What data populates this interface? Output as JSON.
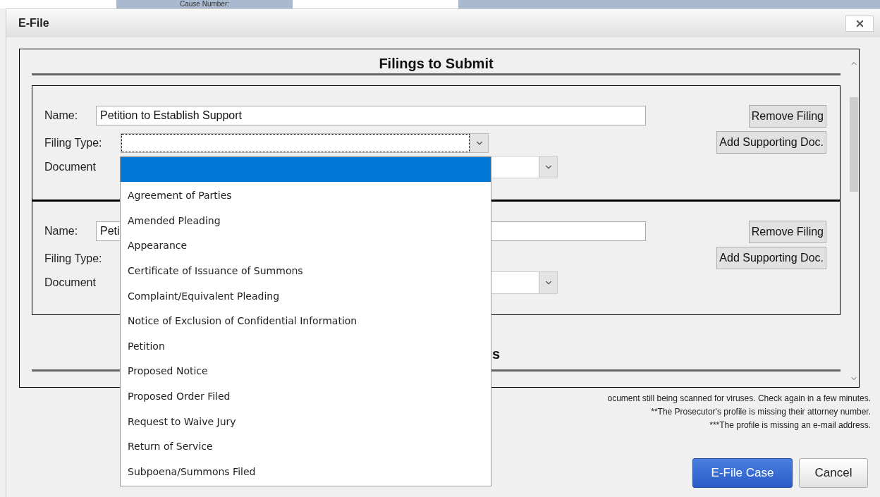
{
  "background": {
    "field_label": "Cause Number:"
  },
  "dialog": {
    "title": "E-File"
  },
  "section_heading": "Filings to Submit",
  "filings": [
    {
      "name_label": "Name:",
      "name_value": "Petition to Establish Support",
      "filing_type_label": "Filing Type:",
      "filing_type_focused": true,
      "document_label": "Document",
      "buttons": [
        "Remove Filing",
        "Add Supporting Doc."
      ]
    },
    {
      "name_label": "Name:",
      "name_value": "Peti",
      "filing_type_label": "Filing Type:",
      "document_label": "Document",
      "buttons": [
        "Remove Filing",
        "Add Supporting Doc."
      ]
    }
  ],
  "second_heading": "s",
  "dropdown": {
    "options": [
      {
        "selected": true
      },
      {
        "label": "Agreement of Parties",
        "selected": false
      },
      {
        "label": "Amended Pleading",
        "selected": false
      },
      {
        "label": "Appearance",
        "selected": false
      },
      {
        "label": "Certificate of Issuance of Summons",
        "selected": false
      },
      {
        "label": "Complaint/Equivalent Pleading",
        "selected": false
      },
      {
        "label": "Notice of Exclusion of Confidential Information",
        "selected": false
      },
      {
        "label": "Petition",
        "selected": false
      },
      {
        "label": "Proposed Notice",
        "selected": false
      },
      {
        "label": "Proposed Order Filed",
        "selected": false
      },
      {
        "label": "Request to Waive Jury",
        "selected": false
      },
      {
        "label": "Return of Service",
        "selected": false
      },
      {
        "label": "Subpoena/Summons Filed",
        "selected": false
      }
    ]
  },
  "notes": [
    "ocument still being scanned for viruses. Check again in a few minutes.",
    "**The Prosecutor's profile is missing their attorney number.",
    "***The profile is missing an e-mail address."
  ],
  "buttons": [
    {
      "label": "E-File Case",
      "kind": "primary"
    },
    {
      "label": "Cancel",
      "kind": "secondary"
    }
  ]
}
